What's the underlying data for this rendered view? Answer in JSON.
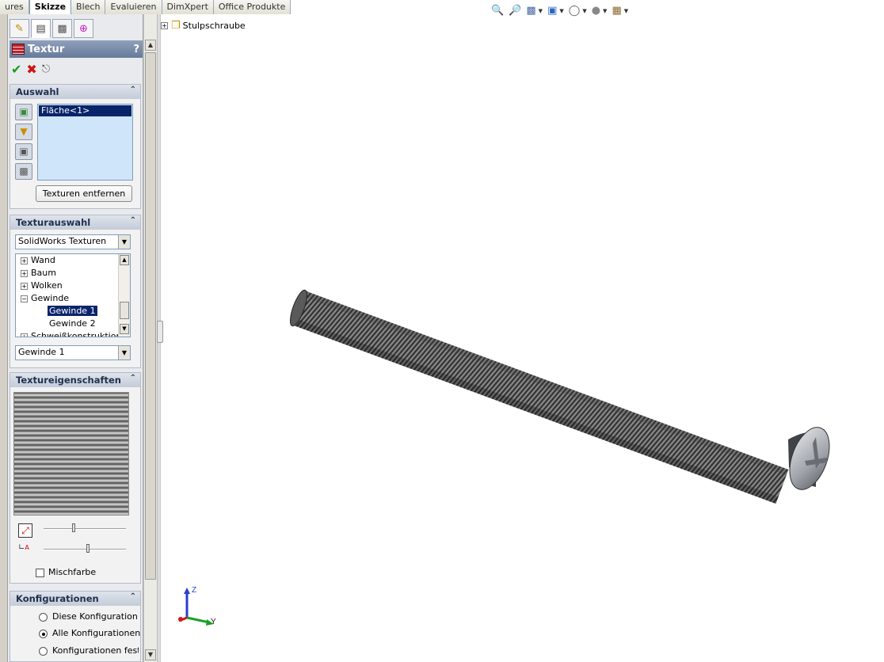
{
  "tabs": [
    "ures",
    "Skizze",
    "Blech",
    "Evaluieren",
    "DimXpert",
    "Office Produkte"
  ],
  "active_tab": "Skizze",
  "panel_icons": [
    "feature-manager-icon",
    "property-manager-icon",
    "configuration-manager-icon",
    "dimxpert-manager-icon"
  ],
  "pm": {
    "title": "Textur",
    "help": "?",
    "auswahl": {
      "header": "Auswahl",
      "selected_face": "Fläche<1>",
      "remove_button": "Texturen entfernen"
    },
    "texturauswahl": {
      "header": "Texturauswahl",
      "library": "SolidWorks Texturen",
      "tree": [
        {
          "label": "Wand",
          "expander": "+"
        },
        {
          "label": "Baum",
          "expander": "+"
        },
        {
          "label": "Wolken",
          "expander": "+"
        },
        {
          "label": "Gewinde",
          "expander": "−"
        },
        {
          "label": "Gewinde 1",
          "child": true,
          "selected": true
        },
        {
          "label": "Gewinde 2",
          "child": true
        },
        {
          "label": "Schweißkonstruktion",
          "expander": "+"
        }
      ],
      "selected": "Gewinde 1"
    },
    "textureigenschaften": {
      "header": "Textureigenschaften",
      "scale_level": 0.35,
      "angle_level": 0.52,
      "blend_label": "Mischfarbe"
    },
    "konfigurationen": {
      "header": "Konfigurationen",
      "options": [
        "Diese Konfiguration",
        "Alle Konfigurationen",
        "Konfigurationen festlegen"
      ],
      "selected": "Alle Konfigurationen"
    }
  },
  "featuretree": {
    "part": "Stulpschraube",
    "expander": "+"
  },
  "view_toolbar": [
    "zoom-to-fit-icon",
    "zoom-area-icon",
    "section-view-icon",
    "view-orientation-icon",
    "display-style-icon",
    "hide-show-icon",
    "edit-appearance-icon",
    "scene-icon"
  ],
  "triad": {
    "z": "Z",
    "y": "Y"
  }
}
